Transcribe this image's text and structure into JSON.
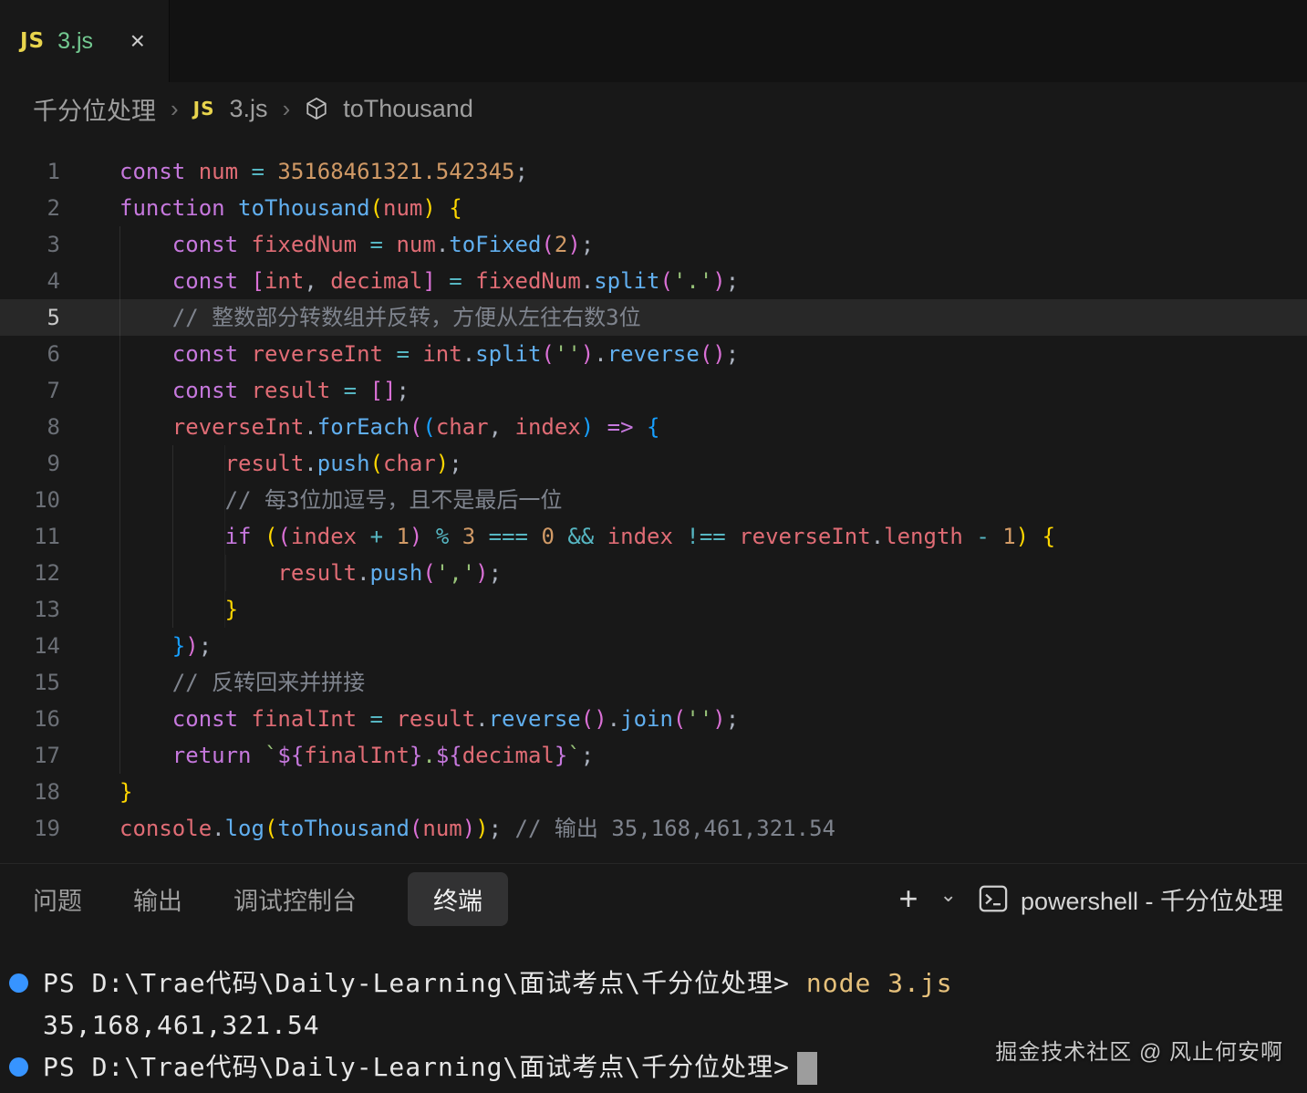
{
  "tab": {
    "icon": "JS",
    "label": "3.js",
    "close": "×"
  },
  "breadcrumb": {
    "folder": "千分位处理",
    "separator": "›",
    "file_icon": "JS",
    "file": "3.js",
    "symbol": "toThousand"
  },
  "editor": {
    "lines": [
      {
        "n": 1,
        "indent": 0,
        "hl": false,
        "tokens": [
          [
            "kw",
            "const "
          ],
          [
            "var",
            "num "
          ],
          [
            "op",
            "= "
          ],
          [
            "num",
            "35168461321.542345"
          ],
          [
            "pun",
            ";"
          ]
        ]
      },
      {
        "n": 2,
        "indent": 0,
        "hl": false,
        "tokens": [
          [
            "kw",
            "function "
          ],
          [
            "fn",
            "toThousand"
          ],
          [
            "b1",
            "("
          ],
          [
            "var",
            "num"
          ],
          [
            "b1",
            ") {"
          ]
        ]
      },
      {
        "n": 3,
        "indent": 4,
        "hl": false,
        "tokens": [
          [
            "kw",
            "const "
          ],
          [
            "var",
            "fixedNum "
          ],
          [
            "op",
            "= "
          ],
          [
            "var",
            "num"
          ],
          [
            "pun",
            "."
          ],
          [
            "fn",
            "toFixed"
          ],
          [
            "b2",
            "("
          ],
          [
            "num",
            "2"
          ],
          [
            "b2",
            ")"
          ],
          [
            "pun",
            ";"
          ]
        ]
      },
      {
        "n": 4,
        "indent": 4,
        "hl": false,
        "tokens": [
          [
            "kw",
            "const "
          ],
          [
            "b2",
            "["
          ],
          [
            "var",
            "int"
          ],
          [
            "pun",
            ", "
          ],
          [
            "var",
            "decimal"
          ],
          [
            "b2",
            "] "
          ],
          [
            "op",
            "= "
          ],
          [
            "var",
            "fixedNum"
          ],
          [
            "pun",
            "."
          ],
          [
            "fn",
            "split"
          ],
          [
            "b2",
            "("
          ],
          [
            "str",
            "'.'"
          ],
          [
            "b2",
            ")"
          ],
          [
            "pun",
            ";"
          ]
        ]
      },
      {
        "n": 5,
        "indent": 4,
        "hl": true,
        "tokens": [
          [
            "cmt",
            "// 整数部分转数组并反转，方便从左往右数3位"
          ]
        ]
      },
      {
        "n": 6,
        "indent": 4,
        "hl": false,
        "tokens": [
          [
            "kw",
            "const "
          ],
          [
            "var",
            "reverseInt "
          ],
          [
            "op",
            "= "
          ],
          [
            "var",
            "int"
          ],
          [
            "pun",
            "."
          ],
          [
            "fn",
            "split"
          ],
          [
            "b2",
            "("
          ],
          [
            "str",
            "''"
          ],
          [
            "b2",
            ")"
          ],
          [
            "pun",
            "."
          ],
          [
            "fn",
            "reverse"
          ],
          [
            "b2",
            "()"
          ],
          [
            "pun",
            ";"
          ]
        ]
      },
      {
        "n": 7,
        "indent": 4,
        "hl": false,
        "tokens": [
          [
            "kw",
            "const "
          ],
          [
            "var",
            "result "
          ],
          [
            "op",
            "= "
          ],
          [
            "b2",
            "[]"
          ],
          [
            "pun",
            ";"
          ]
        ]
      },
      {
        "n": 8,
        "indent": 4,
        "hl": false,
        "tokens": [
          [
            "var",
            "reverseInt"
          ],
          [
            "pun",
            "."
          ],
          [
            "fn",
            "forEach"
          ],
          [
            "b2",
            "("
          ],
          [
            "b3",
            "("
          ],
          [
            "var",
            "char"
          ],
          [
            "pun",
            ", "
          ],
          [
            "var",
            "index"
          ],
          [
            "b3",
            ") "
          ],
          [
            "arrow",
            "=> "
          ],
          [
            "b3",
            "{"
          ]
        ]
      },
      {
        "n": 9,
        "indent": 8,
        "hl": false,
        "tokens": [
          [
            "var",
            "result"
          ],
          [
            "pun",
            "."
          ],
          [
            "fn",
            "push"
          ],
          [
            "b1",
            "("
          ],
          [
            "var",
            "char"
          ],
          [
            "b1",
            ")"
          ],
          [
            "pun",
            ";"
          ]
        ]
      },
      {
        "n": 10,
        "indent": 8,
        "hl": false,
        "tokens": [
          [
            "cmt",
            "// 每3位加逗号，且不是最后一位"
          ]
        ]
      },
      {
        "n": 11,
        "indent": 8,
        "hl": false,
        "tokens": [
          [
            "kw",
            "if "
          ],
          [
            "b1",
            "("
          ],
          [
            "b2",
            "("
          ],
          [
            "var",
            "index "
          ],
          [
            "op",
            "+ "
          ],
          [
            "num",
            "1"
          ],
          [
            "b2",
            ") "
          ],
          [
            "op",
            "% "
          ],
          [
            "num",
            "3 "
          ],
          [
            "op",
            "=== "
          ],
          [
            "num",
            "0 "
          ],
          [
            "op",
            "&& "
          ],
          [
            "var",
            "index "
          ],
          [
            "op",
            "!== "
          ],
          [
            "var",
            "reverseInt"
          ],
          [
            "pun",
            "."
          ],
          [
            "var",
            "length "
          ],
          [
            "op",
            "- "
          ],
          [
            "num",
            "1"
          ],
          [
            "b1",
            ") {"
          ]
        ]
      },
      {
        "n": 12,
        "indent": 12,
        "hl": false,
        "tokens": [
          [
            "var",
            "result"
          ],
          [
            "pun",
            "."
          ],
          [
            "fn",
            "push"
          ],
          [
            "b2",
            "("
          ],
          [
            "str",
            "','"
          ],
          [
            "b2",
            ")"
          ],
          [
            "pun",
            ";"
          ]
        ]
      },
      {
        "n": 13,
        "indent": 8,
        "hl": false,
        "tokens": [
          [
            "b1",
            "}"
          ]
        ]
      },
      {
        "n": 14,
        "indent": 4,
        "hl": false,
        "tokens": [
          [
            "b3",
            "}"
          ],
          [
            "b2",
            ")"
          ],
          [
            "pun",
            ";"
          ]
        ]
      },
      {
        "n": 15,
        "indent": 4,
        "hl": false,
        "tokens": [
          [
            "cmt",
            "// 反转回来并拼接"
          ]
        ]
      },
      {
        "n": 16,
        "indent": 4,
        "hl": false,
        "tokens": [
          [
            "kw",
            "const "
          ],
          [
            "var",
            "finalInt "
          ],
          [
            "op",
            "= "
          ],
          [
            "var",
            "result"
          ],
          [
            "pun",
            "."
          ],
          [
            "fn",
            "reverse"
          ],
          [
            "b2",
            "()"
          ],
          [
            "pun",
            "."
          ],
          [
            "fn",
            "join"
          ],
          [
            "b2",
            "("
          ],
          [
            "str",
            "''"
          ],
          [
            "b2",
            ")"
          ],
          [
            "pun",
            ";"
          ]
        ]
      },
      {
        "n": 17,
        "indent": 4,
        "hl": false,
        "tokens": [
          [
            "kw",
            "return "
          ],
          [
            "str",
            "`"
          ],
          [
            "kw",
            "${"
          ],
          [
            "var",
            "finalInt"
          ],
          [
            "kw",
            "}"
          ],
          [
            "str",
            "."
          ],
          [
            "kw",
            "${"
          ],
          [
            "var",
            "decimal"
          ],
          [
            "kw",
            "}"
          ],
          [
            "str",
            "`"
          ],
          [
            "pun",
            ";"
          ]
        ]
      },
      {
        "n": 18,
        "indent": 0,
        "hl": false,
        "tokens": [
          [
            "b1",
            "}"
          ]
        ]
      },
      {
        "n": 19,
        "indent": 0,
        "hl": false,
        "tokens": [
          [
            "var",
            "console"
          ],
          [
            "pun",
            "."
          ],
          [
            "fn",
            "log"
          ],
          [
            "b1",
            "("
          ],
          [
            "fn",
            "toThousand"
          ],
          [
            "b2",
            "("
          ],
          [
            "var",
            "num"
          ],
          [
            "b2",
            ")"
          ],
          [
            "b1",
            ")"
          ],
          [
            "pun",
            ";"
          ],
          [
            "cmt",
            " // 输出 35,168,461,321.54"
          ]
        ]
      }
    ]
  },
  "panel": {
    "tabs": [
      "问题",
      "输出",
      "调试控制台",
      "终端"
    ],
    "active_tab": "终端",
    "plus_icon": "+",
    "chevron_icon": "⌄",
    "shell_label": "powershell - 千分位处理"
  },
  "terminal": {
    "lines": [
      {
        "bullet": true,
        "cursor": false,
        "segments": [
          [
            "plain",
            "PS D:\\Trae代码\\Daily-Learning\\面试考点\\千分位处理> "
          ],
          [
            "cmd",
            "node 3.js"
          ]
        ]
      },
      {
        "bullet": false,
        "cursor": false,
        "segments": [
          [
            "plain",
            "35,168,461,321.54"
          ]
        ]
      },
      {
        "bullet": true,
        "cursor": true,
        "segments": [
          [
            "plain",
            "PS D:\\Trae代码\\Daily-Learning\\面试考点\\千分位处理>"
          ]
        ]
      }
    ]
  },
  "watermark": "掘金技术社区 @ 风止何安啊",
  "colors": {
    "kw": "#c678dd",
    "var": "#e06c75",
    "fn": "#61afef",
    "num": "#d19a66",
    "str": "#98c379",
    "cmt": "#7f848e",
    "op": "#56b6c2",
    "arrow": "#c678dd",
    "pun": "#abb2bf",
    "b1": "#ffd700",
    "b2": "#da70d6",
    "b3": "#179fff",
    "plain": "#e6e6e6",
    "cmd": "#e5c07b",
    "bullet": "#3794ff",
    "cursor": "#9d9d9d",
    "tab_file": "#73c991",
    "js_icon": "#e8d44d"
  }
}
